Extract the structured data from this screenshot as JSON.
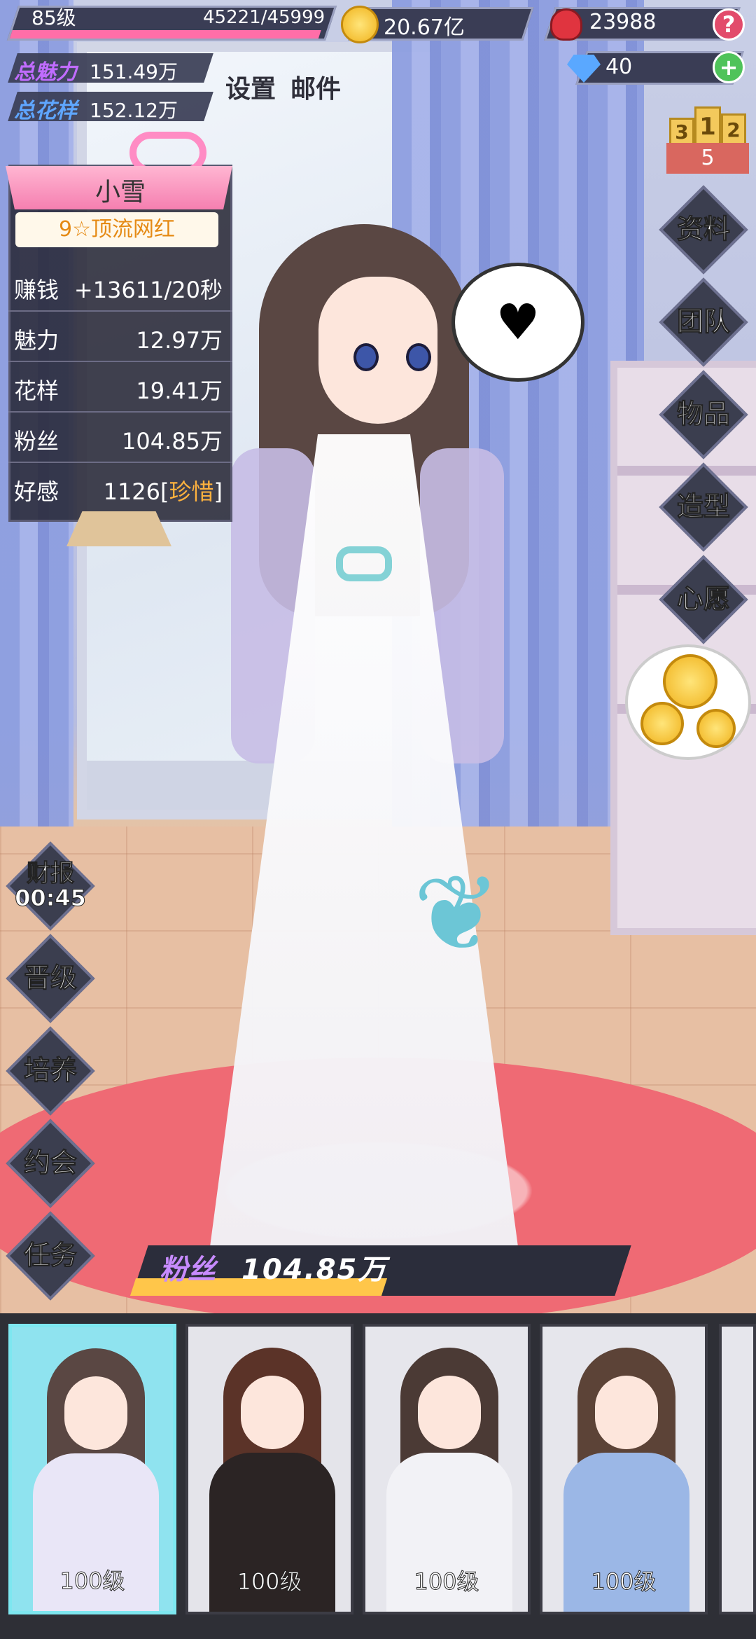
{
  "player": {
    "level_label": "85级",
    "xp_text": "45221/45999",
    "xp_progress": 0.983,
    "total_charm_label": "总魅力",
    "total_charm_value": "151.49万",
    "total_style_label": "总花样",
    "total_style_value": "152.12万"
  },
  "resources": {
    "gold": "20.67亿",
    "roses": "23988",
    "diamonds": "40"
  },
  "top_links": {
    "settings": "设置",
    "mail": "邮件"
  },
  "rank_badge": {
    "podium_1": "1",
    "podium_2": "2",
    "podium_3": "3",
    "rank": "5"
  },
  "character": {
    "name": "小雪",
    "title": "9☆顶流网红",
    "stats": [
      {
        "label": "赚钱",
        "value": "+13611/20秒"
      },
      {
        "label": "魅力",
        "value": "12.97万"
      },
      {
        "label": "花样",
        "value": "19.41万"
      },
      {
        "label": "粉丝",
        "value": "104.85万"
      }
    ],
    "affection_label": "好感",
    "affection_value": "1126",
    "affection_tier": "珍惜"
  },
  "right_menu": [
    "资料",
    "团队",
    "物品",
    "造型",
    "心愿"
  ],
  "left_menu": {
    "report_label": "财报",
    "report_timer": "00:45",
    "items": [
      "晋级",
      "培养",
      "约会",
      "任务"
    ]
  },
  "fans_bar": {
    "label": "粉丝",
    "value": "104.85万",
    "progress": 0.52
  },
  "roster": [
    {
      "level": "100级",
      "bg": "#8fe3ef",
      "hair": "#5a4743",
      "outfit": "#e9e6f7"
    },
    {
      "level": "100级",
      "bg": "#e4e4ea",
      "hair": "#5b3328",
      "outfit": "#2b2424"
    },
    {
      "level": "100级",
      "bg": "#e6e6ec",
      "hair": "#4b3a35",
      "outfit": "#f2f2f6"
    },
    {
      "level": "100级",
      "bg": "#e6e6ec",
      "hair": "#5c4337",
      "outfit": "#9bb7e6"
    }
  ],
  "icons": {
    "help": "question-icon",
    "add": "plus-icon",
    "gold": "gold-coin-icon",
    "rose": "rose-icon",
    "diamond": "diamond-icon"
  },
  "colors": {
    "xp_fill": "#ff6ea8",
    "fans_fill": "#ffc64a",
    "title_text": "#e58a14",
    "affection_tier": "#ffb23e"
  }
}
